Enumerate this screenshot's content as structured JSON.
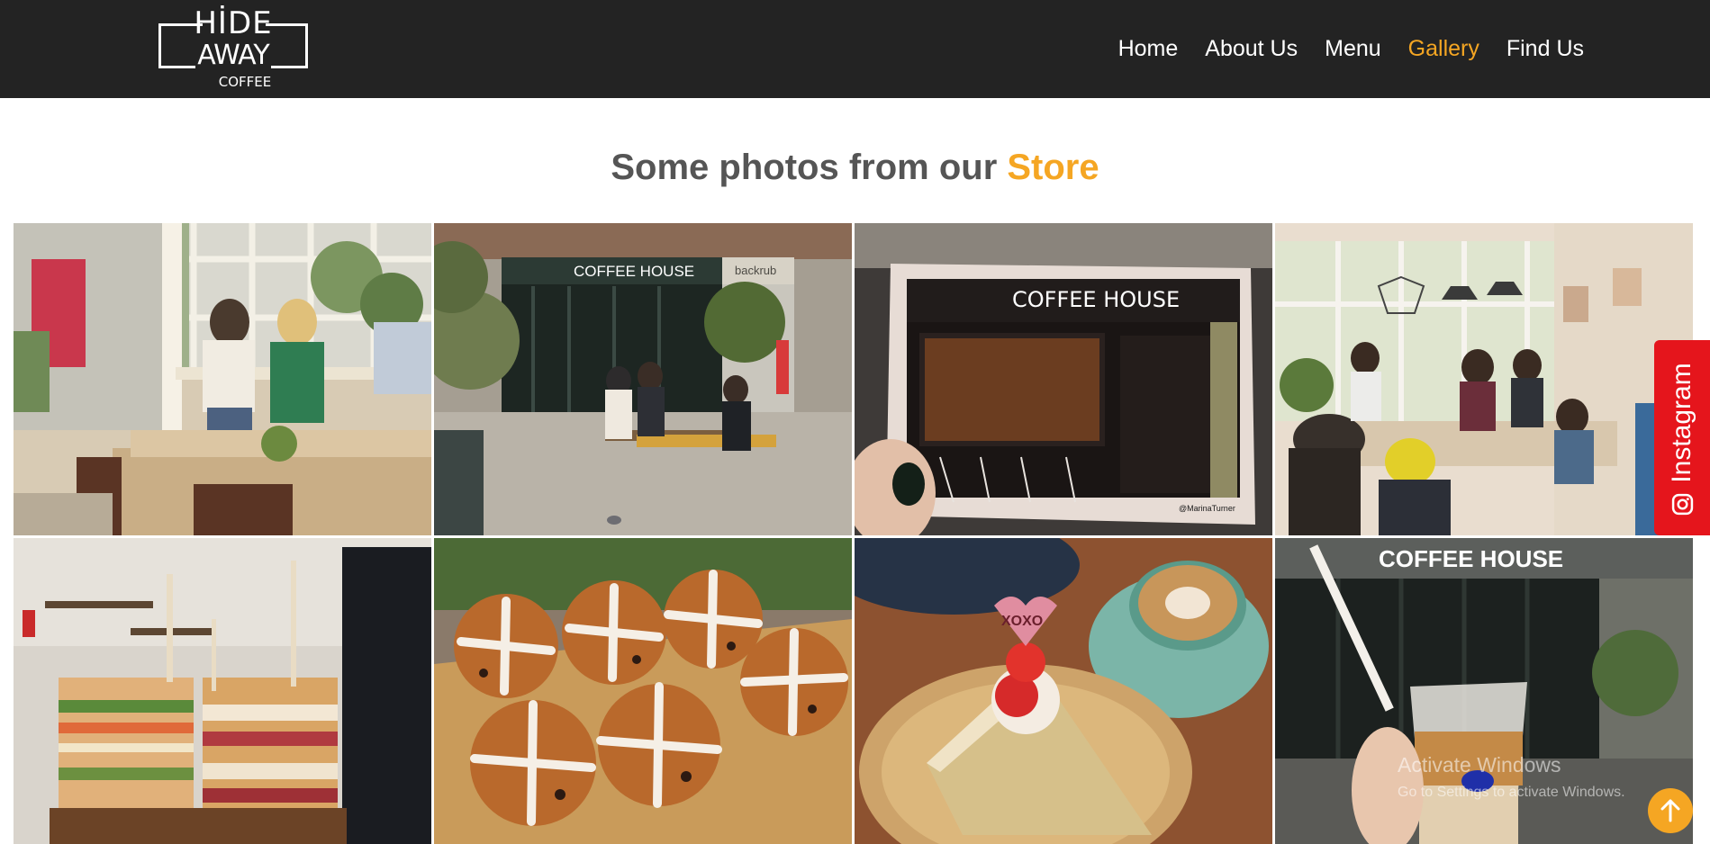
{
  "brand": {
    "logo_line1": "HİDE",
    "logo_line2": "AWAY",
    "logo_line3": "COFFEE"
  },
  "nav": {
    "items": [
      {
        "label": "Home",
        "active": false
      },
      {
        "label": "About Us",
        "active": false
      },
      {
        "label": "Menu",
        "active": false
      },
      {
        "label": "Gallery",
        "active": true
      },
      {
        "label": "Find Us",
        "active": false
      }
    ]
  },
  "section": {
    "title_prefix": "Some photos from our ",
    "title_accent": "Store"
  },
  "gallery": {
    "photos": [
      {
        "name": "cafe-interior-window-seating",
        "sign_text": ""
      },
      {
        "name": "coffee-house-storefront-courtyard",
        "sign_text": "COFFEE HOUSE",
        "sign_text_2": "backrub"
      },
      {
        "name": "coffee-house-illustration-card",
        "sign_text": "COFFEE HOUSE",
        "caption": "@MarinaTurner"
      },
      {
        "name": "cafe-interior-people-tables",
        "sign_text": ""
      },
      {
        "name": "sandwiches-display",
        "sign_text": ""
      },
      {
        "name": "hot-cross-buns",
        "sign_text": ""
      },
      {
        "name": "cake-and-latte",
        "sign_text": "XOXO"
      },
      {
        "name": "iced-latte-storefront",
        "sign_text": "COFFEE HOUSE"
      }
    ]
  },
  "instagram": {
    "label": "Instagram"
  },
  "watermark": {
    "line1": "Activate Windows",
    "line2": "Go to Settings to activate Windows."
  },
  "colors": {
    "header_bg": "#232323",
    "accent": "#f5a623",
    "title_gray": "#555555",
    "instagram_red": "#e5151c"
  }
}
